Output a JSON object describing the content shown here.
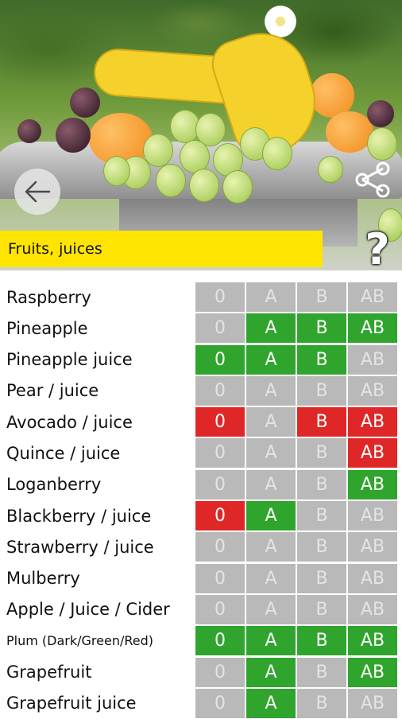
{
  "header": {
    "category": "Fruits, juices",
    "help_label": "?",
    "icons": {
      "back": "arrow-left-icon",
      "share": "share-icon"
    }
  },
  "blood_types": [
    "0",
    "A",
    "B",
    "AB"
  ],
  "colors": {
    "green": "#2fa52d",
    "red": "#e02727",
    "neutral": "#b9b9b9",
    "category_bar": "#ffe400"
  },
  "items": [
    {
      "name": "Raspberry",
      "ratings": [
        "neutral",
        "neutral",
        "neutral",
        "neutral"
      ]
    },
    {
      "name": "Pineapple",
      "ratings": [
        "neutral",
        "green",
        "green",
        "green"
      ]
    },
    {
      "name": "Pineapple juice",
      "ratings": [
        "green",
        "green",
        "green",
        "neutral"
      ]
    },
    {
      "name": "Pear / juice",
      "ratings": [
        "neutral",
        "neutral",
        "neutral",
        "neutral"
      ]
    },
    {
      "name": "Avocado / juice",
      "ratings": [
        "red",
        "neutral",
        "red",
        "red"
      ]
    },
    {
      "name": "Quince / juice",
      "ratings": [
        "neutral",
        "neutral",
        "neutral",
        "red"
      ]
    },
    {
      "name": "Loganberry",
      "ratings": [
        "neutral",
        "neutral",
        "neutral",
        "green"
      ]
    },
    {
      "name": "Blackberry / juice",
      "ratings": [
        "red",
        "green",
        "neutral",
        "neutral"
      ]
    },
    {
      "name": "Strawberry / juice",
      "ratings": [
        "neutral",
        "neutral",
        "neutral",
        "neutral"
      ]
    },
    {
      "name": "Mulberry",
      "ratings": [
        "neutral",
        "neutral",
        "neutral",
        "neutral"
      ]
    },
    {
      "name": "Apple / Juice / Cider",
      "ratings": [
        "neutral",
        "neutral",
        "neutral",
        "neutral"
      ]
    },
    {
      "name": "Plum (Dark/Green/Red)",
      "ratings": [
        "green",
        "green",
        "green",
        "green"
      ],
      "small": true
    },
    {
      "name": "Grapefruit",
      "ratings": [
        "neutral",
        "green",
        "neutral",
        "green"
      ]
    },
    {
      "name": "Grapefruit juice",
      "ratings": [
        "neutral",
        "green",
        "neutral",
        "neutral"
      ]
    }
  ]
}
